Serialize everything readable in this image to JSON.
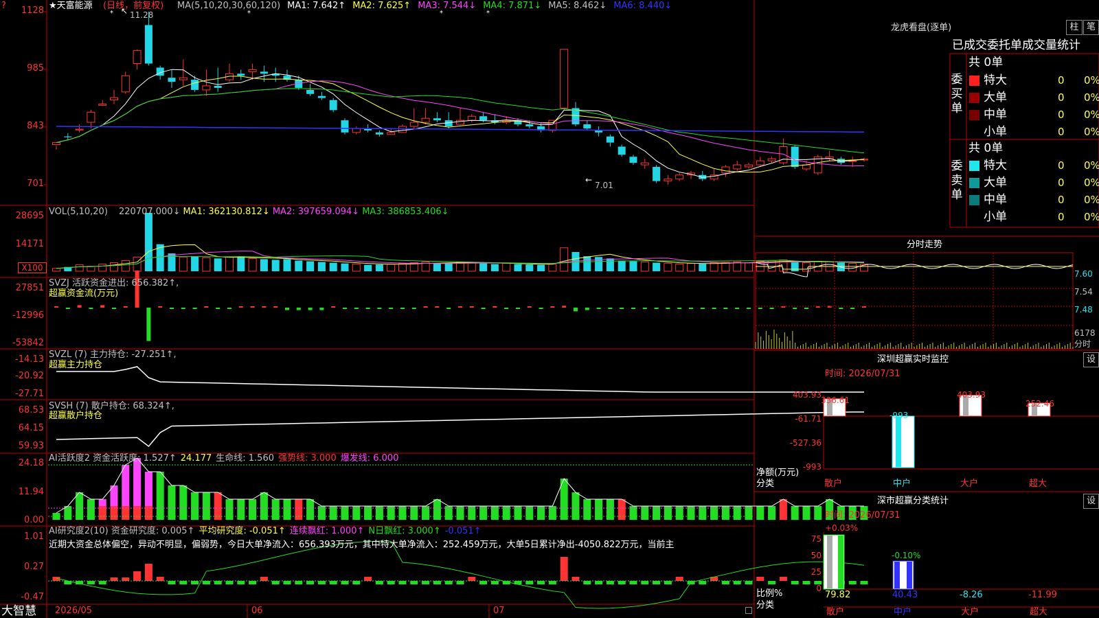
{
  "colors": {
    "up": "#ff3333",
    "down": "#22d6e6",
    "green": "#22dd22",
    "magenta": "#ff44ff",
    "yellow": "#ffff44",
    "white": "#ffffff",
    "blue": "#3333ff",
    "border": "#c00000"
  },
  "main": {
    "title": "★天富能源",
    "mode": "(日线，前复权)",
    "ma_text": [
      {
        "label": "MA(5,10,20,30,60,120)",
        "color": "#c0c0c0"
      },
      {
        "label": "MA1: 7.642↑",
        "color": "#ffffff"
      },
      {
        "label": "MA2: 7.625↑",
        "color": "#ffff44"
      },
      {
        "label": "MA3: 7.544↓",
        "color": "#ff44ff"
      },
      {
        "label": "MA4: 7.871↓",
        "color": "#22dd22"
      },
      {
        "label": "MA5: 8.462↓",
        "color": "#c0c0c0"
      },
      {
        "label": "MA6: 8.440↓",
        "color": "#3333ff"
      }
    ],
    "y_ticks": [
      "1128",
      "985",
      "843",
      "701"
    ],
    "high_label": "11.28",
    "low_label": "7.01",
    "marker_question": "?"
  },
  "vol": {
    "label": "VOL(5,10,20)",
    "items": [
      {
        "label": "220707.000↓",
        "color": "#c0c0c0"
      },
      {
        "label": "MA1: 362130.812↓",
        "color": "#ffff44"
      },
      {
        "label": "MA2: 397659.094↓",
        "color": "#ff44ff"
      },
      {
        "label": "MA3: 386853.406↓",
        "color": "#22dd22"
      }
    ],
    "y_ticks": [
      "28695",
      "14171"
    ],
    "unit_button": "X100"
  },
  "svzj": {
    "label": "SVZJ  活跃资金进出: 656.382↑,",
    "sub": "超赢资金流(万元)",
    "y_ticks": [
      "27851",
      "-12996",
      "-53842"
    ]
  },
  "svzl": {
    "label": "SVZL (7) 主力持仓: -27.251↑,",
    "sub": "超赢主力持仓",
    "y_ticks": [
      "-14.13",
      "-20.92",
      "-27.71"
    ]
  },
  "svsh": {
    "label": "SVSH (7) 散户持仓: 68.324↑,",
    "sub": "超赢散户持仓",
    "y_ticks": [
      "68.53",
      "64.15",
      "59.93"
    ]
  },
  "ai_active": {
    "items": [
      {
        "label": "AI活跃度2 资金活跃度: 1.527↑",
        "color": "#c0c0c0"
      },
      {
        "label": "24.177",
        "color": "#ffff44"
      },
      {
        "label": "生命线: 1.560",
        "color": "#c0c0c0"
      },
      {
        "label": "强势线: 3.000",
        "color": "#ff3333"
      },
      {
        "label": "爆发线: 6.000",
        "color": "#ff44ff"
      }
    ],
    "y_ticks": [
      "24.18",
      "11.94",
      "0.00"
    ]
  },
  "ai_research": {
    "items": [
      {
        "label": "AI研究度2(10) 资金研究度: 0.005↑",
        "color": "#c0c0c0"
      },
      {
        "label": "平均研究度: -0.051↑",
        "color": "#ffff44"
      },
      {
        "label": "连续飘红: 1.000↑",
        "color": "#ff44ff"
      },
      {
        "label": "N日飘红: 3.000↑",
        "color": "#22dd22"
      },
      {
        "label": "-0.051↑",
        "color": "#3333ff"
      }
    ],
    "comment": "近期大资金总体偏空，异动不明显，偏弱势，今日大单净流入：656.393万元，其中特大单净流入：252.459万元，大单5日累计净出-4050.822万元，当前主",
    "y_ticks": [
      "1.01",
      "0.27",
      "-0.47"
    ]
  },
  "bottom": {
    "brand": "大智慧",
    "dates": [
      "2026/05",
      "06",
      "07"
    ]
  },
  "candles": [
    [
      8.0,
      8.05,
      7.98,
      7.88
    ],
    [
      8.2,
      8.18,
      8.28,
      8.1
    ],
    [
      8.36,
      8.38,
      8.5,
      8.3
    ],
    [
      8.55,
      8.8,
      8.86,
      8.4
    ],
    [
      8.97,
      9.0,
      9.1,
      8.95
    ],
    [
      9.1,
      9.16,
      9.35,
      9.0
    ],
    [
      9.3,
      9.7,
      9.8,
      9.25
    ],
    [
      10.0,
      10.32,
      10.35,
      9.85
    ],
    [
      10.95,
      10.0,
      11.28,
      9.95
    ],
    [
      9.9,
      9.7,
      9.95,
      9.6
    ],
    [
      9.65,
      9.55,
      9.85,
      9.4
    ],
    [
      9.6,
      9.65,
      10.1,
      9.45
    ],
    [
      9.6,
      9.35,
      9.7,
      9.3
    ],
    [
      9.35,
      9.45,
      9.85,
      9.2
    ],
    [
      9.45,
      9.4,
      9.9,
      9.3
    ],
    [
      9.6,
      9.75,
      10.0,
      9.55
    ],
    [
      9.75,
      9.7,
      9.85,
      9.6
    ],
    [
      9.8,
      9.85,
      10.0,
      9.6
    ],
    [
      9.8,
      9.75,
      9.95,
      9.55
    ],
    [
      9.75,
      9.7,
      9.9,
      9.55
    ],
    [
      9.7,
      9.6,
      9.85,
      9.55
    ],
    [
      9.6,
      9.4,
      9.7,
      9.35
    ],
    [
      9.35,
      9.25,
      9.5,
      9.2
    ],
    [
      9.2,
      9.15,
      9.3,
      9.1
    ],
    [
      9.1,
      8.85,
      9.15,
      8.8
    ],
    [
      8.6,
      8.3,
      8.65,
      8.25
    ],
    [
      8.3,
      8.4,
      8.45,
      8.25
    ],
    [
      8.4,
      8.35,
      8.5,
      8.3
    ],
    [
      8.3,
      8.25,
      8.35,
      8.2
    ],
    [
      8.25,
      8.3,
      8.4,
      8.25
    ],
    [
      8.3,
      8.45,
      8.5,
      8.3
    ],
    [
      8.45,
      8.55,
      8.9,
      8.4
    ],
    [
      8.55,
      8.65,
      8.9,
      8.5
    ],
    [
      8.65,
      8.6,
      8.8,
      8.55
    ],
    [
      8.6,
      8.45,
      8.8,
      8.4
    ],
    [
      8.5,
      8.6,
      8.9,
      8.5
    ],
    [
      8.6,
      8.7,
      8.75,
      8.55
    ],
    [
      8.7,
      8.6,
      8.8,
      8.55
    ],
    [
      8.6,
      8.55,
      8.75,
      8.5
    ],
    [
      8.55,
      8.6,
      8.7,
      8.5
    ],
    [
      8.6,
      8.5,
      8.65,
      8.45
    ],
    [
      8.5,
      8.45,
      8.6,
      8.4
    ],
    [
      8.45,
      8.35,
      8.55,
      8.3
    ],
    [
      8.35,
      8.6,
      8.6,
      8.3
    ],
    [
      8.9,
      10.35,
      10.35,
      8.85
    ],
    [
      8.9,
      8.5,
      9.05,
      8.45
    ],
    [
      8.5,
      8.4,
      8.6,
      8.35
    ],
    [
      8.35,
      8.3,
      8.45,
      8.2
    ],
    [
      8.2,
      8.05,
      8.25,
      7.95
    ],
    [
      7.95,
      7.75,
      8.0,
      7.7
    ],
    [
      7.7,
      7.55,
      7.75,
      7.5
    ],
    [
      7.5,
      7.55,
      7.65,
      7.4
    ],
    [
      7.45,
      7.1,
      7.5,
      7.05
    ],
    [
      7.1,
      7.15,
      7.25,
      7.01
    ],
    [
      7.15,
      7.25,
      7.3,
      7.1
    ],
    [
      7.25,
      7.3,
      7.35,
      7.15
    ],
    [
      7.25,
      7.15,
      7.35,
      7.1
    ],
    [
      7.15,
      7.25,
      7.4,
      7.1
    ],
    [
      7.3,
      7.45,
      7.5,
      7.2
    ],
    [
      7.4,
      7.5,
      7.6,
      7.35
    ],
    [
      7.45,
      7.5,
      7.55,
      7.4
    ],
    [
      7.5,
      7.6,
      7.7,
      7.45
    ],
    [
      7.6,
      7.65,
      7.7,
      7.55
    ],
    [
      7.55,
      7.95,
      8.15,
      7.5
    ],
    [
      7.95,
      7.45,
      8.0,
      7.4
    ],
    [
      7.4,
      7.5,
      7.6,
      7.35
    ],
    [
      7.3,
      7.7,
      7.75,
      7.25
    ],
    [
      7.65,
      7.7,
      7.85,
      7.6
    ],
    [
      7.65,
      7.55,
      7.7,
      7.5
    ],
    [
      7.6,
      7.6,
      7.7,
      7.45
    ],
    [
      7.62,
      7.64,
      7.68,
      7.58
    ]
  ],
  "right": {
    "lhk_title": "龙虎看盘(逐单)",
    "lhk_buttons": [
      "柱",
      "笔"
    ],
    "order_title": "已成交委托单成交量统计",
    "buy_label": "委买单",
    "sell_label": "委卖单",
    "buy_total": "共 0单",
    "sell_total": "共 0单",
    "buy_rows": [
      {
        "label": "特大",
        "val": "0",
        "pct": "0%",
        "color": "#ff2020"
      },
      {
        "label": "大单",
        "val": "0",
        "pct": "0%",
        "color": "#9a0000"
      },
      {
        "label": "中单",
        "val": "0",
        "pct": "0%",
        "color": "#7a0000"
      },
      {
        "label": "小单",
        "val": "0",
        "pct": "0%",
        "color": ""
      }
    ],
    "sell_rows": [
      {
        "label": "特大",
        "val": "0",
        "pct": "0%",
        "color": "#22e6ee"
      },
      {
        "label": "大单",
        "val": "0",
        "pct": "0%",
        "color": "#0e9a9a"
      },
      {
        "label": "中单",
        "val": "0",
        "pct": "0%",
        "color": "#0a7a7a"
      },
      {
        "label": "小单",
        "val": "0",
        "pct": "0%",
        "color": ""
      }
    ],
    "fs_title": "分时走势",
    "fs_ticks": [
      "7.60",
      "7.54",
      "7.48",
      "6178"
    ],
    "fs_unit": "分时",
    "sz_title": "深圳超赢实时监控",
    "sz_time": "时间: 2026/07/31",
    "sz_button": "设",
    "sz_ticks": [
      "403.93",
      "-61.71",
      "-527.36",
      "-993"
    ],
    "sz_ylabel": "净额(万元)",
    "sz_xlabel": "分类",
    "sz_cats": [
      "散户",
      "中户",
      "大户",
      "超大"
    ],
    "sz_values": [
      336.61,
      -993,
      403.93,
      252.46
    ],
    "sz_labels": [
      "336.61",
      "-993",
      "403.93",
      "252.46"
    ],
    "ss_title": "深市超赢分类统计",
    "ss_time": "时间: 2026/07/31",
    "ss_button": "设",
    "ss_ticks": [
      "75",
      "50",
      "25",
      "0"
    ],
    "ss_ylabel": "比例%",
    "ss_xlabel": "分类",
    "ss_top_labels": [
      "+0.03%",
      "-0.10%"
    ],
    "ss_bottom_values": [
      "79.82",
      "40.43",
      "-8.26",
      "-11.99"
    ],
    "ss_cats": [
      "散户",
      "中户",
      "大户",
      "超大"
    ]
  }
}
